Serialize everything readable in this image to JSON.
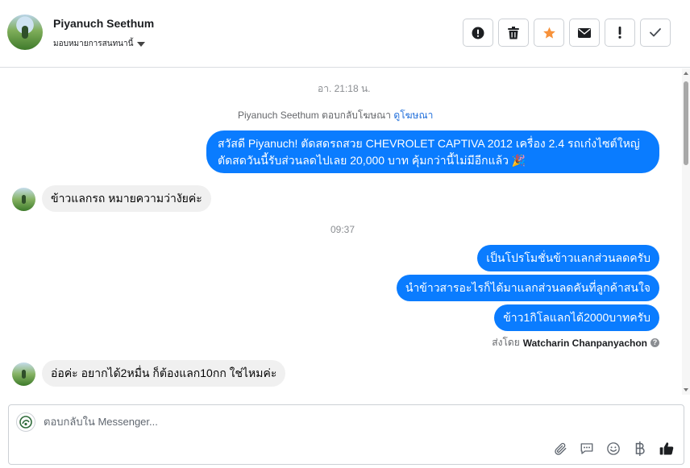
{
  "header": {
    "contact_name": "Piyanuch Seethum",
    "assign_label": "มอบหมายการสนทนานี้",
    "actions": [
      {
        "icon": "alert-circle-icon",
        "name": "mark-spam-button"
      },
      {
        "icon": "trash-icon",
        "name": "delete-button"
      },
      {
        "icon": "star-icon",
        "name": "star-button"
      },
      {
        "icon": "envelope-icon",
        "name": "mark-unread-button"
      },
      {
        "icon": "exclamation-icon",
        "name": "follow-up-button"
      },
      {
        "icon": "check-icon",
        "name": "mark-done-button"
      }
    ],
    "star_color": "#f7923b"
  },
  "chat": {
    "timestamp_1": "อา. 21:18 น.",
    "reply_note": {
      "text": "Piyanuch Seethum ตอบกลับโฆษณา",
      "link": "ดูโฆษณา"
    },
    "messages": [
      {
        "from": "page",
        "text": "สวัสดี Piyanuch! ตัดสดรถสวย CHEVROLET CAPTIVA 2012 เครื่อง 2.4 รถเก๋งไซต์ใหญ่ ตัดสดวันนี้รับส่วนลดไปเลย 20,000 บาท คุ้มกว่านี้ไม่มีอีกแล้ว 🎉"
      },
      {
        "from": "user",
        "text": "ข้าวแลกรถ หมายความว่างัยค่ะ"
      },
      {
        "from": "page",
        "text": "เป็นโปรโมชั่นข้าวแลกส่วนลดครับ"
      },
      {
        "from": "page",
        "text": "นำข้าวสารอะไรก็ได้มาแลกส่วนลดคันที่ลูกค้าสนใจ"
      },
      {
        "from": "page",
        "text": "ข้าว1กิโลแลกได้2000บาทครับ"
      },
      {
        "from": "user",
        "text": "อ่อค่ะ อยากได้2หมื่น ก็ต้องแลก10กก ใช่ไหมค่ะ"
      }
    ],
    "timestamp_2": "09:37",
    "sent_by_label": "ส่งโดย",
    "sent_by_name": "Watcharin Chanpanyachon",
    "help_glyph": "?",
    "outgoing_color": "#0a7cff",
    "incoming_color": "#f0f0f0"
  },
  "composer": {
    "placeholder": "ตอบกลับใน Messenger...",
    "tools": [
      "paperclip-icon",
      "saved-reply-icon",
      "emoji-icon",
      "baht-icon",
      "like-icon"
    ]
  }
}
